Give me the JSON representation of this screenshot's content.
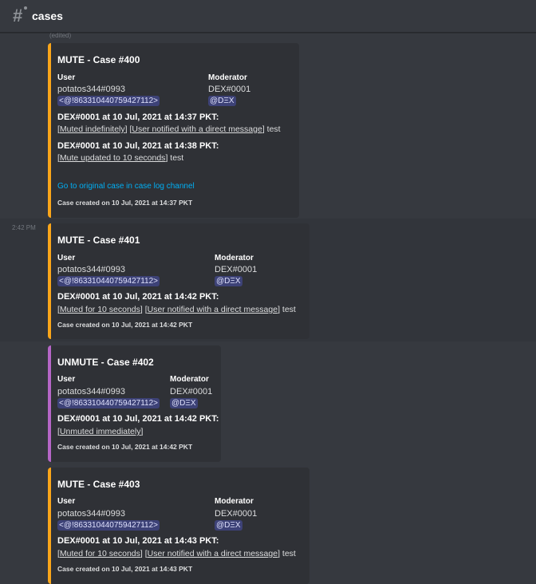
{
  "channel": {
    "name": "cases"
  },
  "edited_label": "(edited)",
  "timestamp_label": "2:42 PM",
  "icons": {
    "channel": "hashtag-thread-icon"
  },
  "colors": {
    "mute": "#faa61a",
    "unmute": "#b666c7",
    "link": "#00aff4",
    "mention_bg": "#5865f2"
  },
  "embeds": [
    {
      "title": "MUTE - Case #400",
      "user_label": "User",
      "user_value": "potatos344#0993",
      "user_mention": "<@!863310440759427112>",
      "moderator_label": "Moderator",
      "moderator_value": "DEX#0001",
      "moderator_mention": "@DΞX",
      "entries": [
        {
          "head": "DEX#0001 at 10 Jul, 2021 at 14:37 PKT:",
          "tags": [
            "Muted indefinitely",
            "User notified with a direct message"
          ],
          "note": "test"
        },
        {
          "head": "DEX#0001 at 10 Jul, 2021 at 14:38 PKT:",
          "tags": [
            "Mute updated to 10 seconds"
          ],
          "note": "test"
        }
      ],
      "link": "Go to original case in case log channel",
      "footer": "Case created on 10 Jul, 2021 at 14:37 PKT"
    },
    {
      "title": "MUTE - Case #401",
      "user_label": "User",
      "user_value": "potatos344#0993",
      "user_mention": "<@!863310440759427112>",
      "moderator_label": "Moderator",
      "moderator_value": "DEX#0001",
      "moderator_mention": "@DΞX",
      "entries": [
        {
          "head": "DEX#0001 at 10 Jul, 2021 at 14:42 PKT:",
          "tags": [
            "Muted for 10 seconds",
            "User notified with a direct message"
          ],
          "note": "test"
        }
      ],
      "footer": "Case created on 10 Jul, 2021 at 14:42 PKT"
    },
    {
      "title": "UNMUTE - Case #402",
      "user_label": "User",
      "user_value": "potatos344#0993",
      "user_mention": "<@!863310440759427112>",
      "moderator_label": "Moderator",
      "moderator_value": "DEX#0001",
      "moderator_mention": "@DΞX",
      "entries": [
        {
          "head": "DEX#0001 at 10 Jul, 2021 at 14:42 PKT:",
          "tags": [
            "Unmuted immediately"
          ],
          "note": ""
        }
      ],
      "footer": "Case created on 10 Jul, 2021 at 14:42 PKT"
    },
    {
      "title": "MUTE - Case #403",
      "user_label": "User",
      "user_value": "potatos344#0993",
      "user_mention": "<@!863310440759427112>",
      "moderator_label": "Moderator",
      "moderator_value": "DEX#0001",
      "moderator_mention": "@DΞX",
      "entries": [
        {
          "head": "DEX#0001 at 10 Jul, 2021 at 14:43 PKT:",
          "tags": [
            "Muted for 10 seconds",
            "User notified with a direct message"
          ],
          "note": "test"
        }
      ],
      "footer": "Case created on 10 Jul, 2021 at 14:43 PKT"
    }
  ]
}
